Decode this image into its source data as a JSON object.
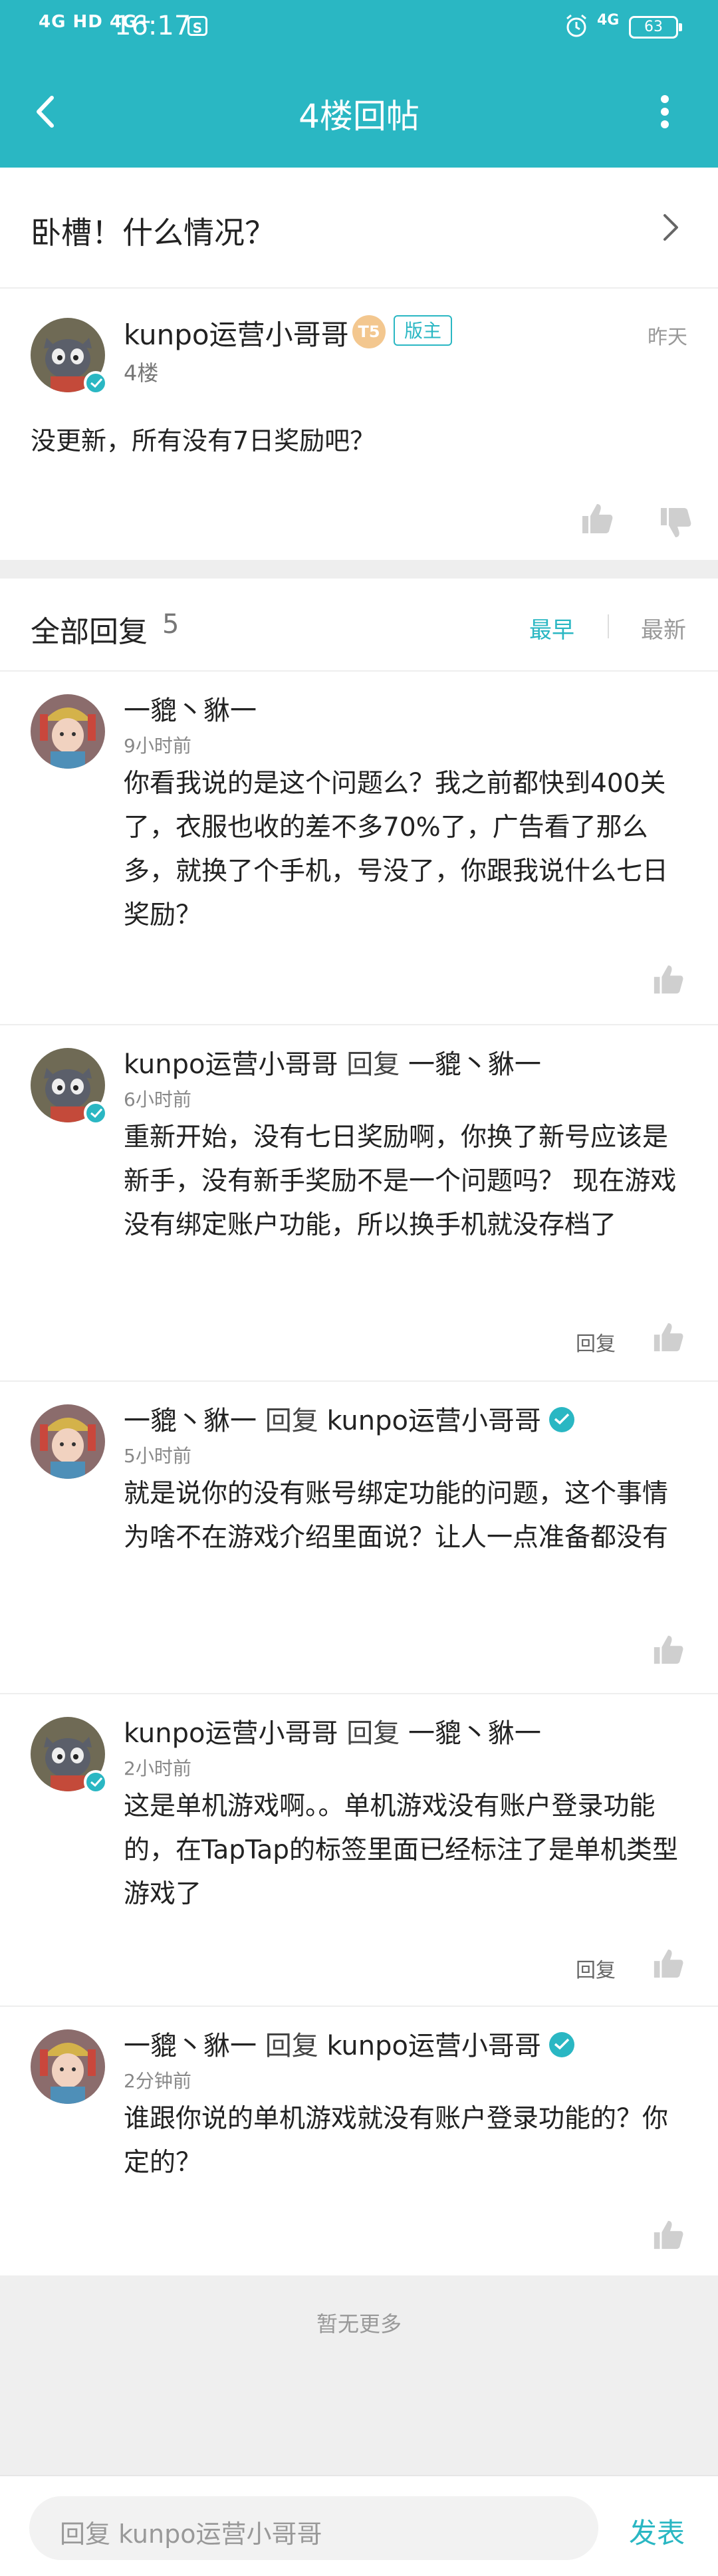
{
  "status_bar": {
    "signal_text": "4G HD 4G+",
    "time": "16:17",
    "s_icon": "S",
    "network": "4G",
    "battery": "63"
  },
  "nav": {
    "title": "4楼回帖"
  },
  "topic": {
    "title": "卧槽！什么情况？"
  },
  "main_post": {
    "author": "kunpo运营小哥哥",
    "level_badge": "T5",
    "role_badge": "版主",
    "floor": "4楼",
    "date": "昨天",
    "content": "没更新，所有没有7日奖励吧？"
  },
  "replies_header": {
    "label": "全部回复",
    "count": "5",
    "sort_earliest": "最早",
    "sort_latest": "最新"
  },
  "replies": [
    {
      "author": "一貔丶貅一",
      "reply_to": "",
      "time": "9小时前",
      "text": "你看我说的是这个问题么？我之前都快到400关了，衣服也收的差不多70%了，广告看了那么多，就换了个手机，号没了，你跟我说什么七日奖励？",
      "reply_label": ""
    },
    {
      "author": "kunpo运营小哥哥",
      "reply_word": "回复",
      "reply_to": "一貔丶貅一",
      "time": "6小时前",
      "text": "重新开始，没有七日奖励啊，你换了新号应该是新手，没有新手奖励不是一个问题吗？ 现在游戏没有绑定账户功能，所以换手机就没存档了",
      "reply_label": "回复"
    },
    {
      "author": "一貔丶貅一",
      "reply_word": "回复",
      "reply_to": "kunpo运营小哥哥",
      "time": "5小时前",
      "text": "就是说你的没有账号绑定功能的问题，这个事情为啥不在游戏介绍里面说？让人一点准备都没有",
      "reply_label": ""
    },
    {
      "author": "kunpo运营小哥哥",
      "reply_word": "回复",
      "reply_to": "一貔丶貅一",
      "time": "2小时前",
      "text": "这是单机游戏啊。。单机游戏没有账户登录功能的，在TapTap的标签里面已经标注了是单机类型游戏了",
      "reply_label": "回复"
    },
    {
      "author": "一貔丶貅一",
      "reply_word": "回复",
      "reply_to": "kunpo运营小哥哥",
      "time": "2分钟前",
      "text": "谁跟你说的单机游戏就没有账户登录功能的？你定的？",
      "reply_label": ""
    }
  ],
  "footer": {
    "no_more": "暂无更多",
    "input_placeholder": "回复 kunpo运营小哥哥",
    "send": "发表"
  },
  "colors": {
    "accent": "#2ab7c3"
  }
}
